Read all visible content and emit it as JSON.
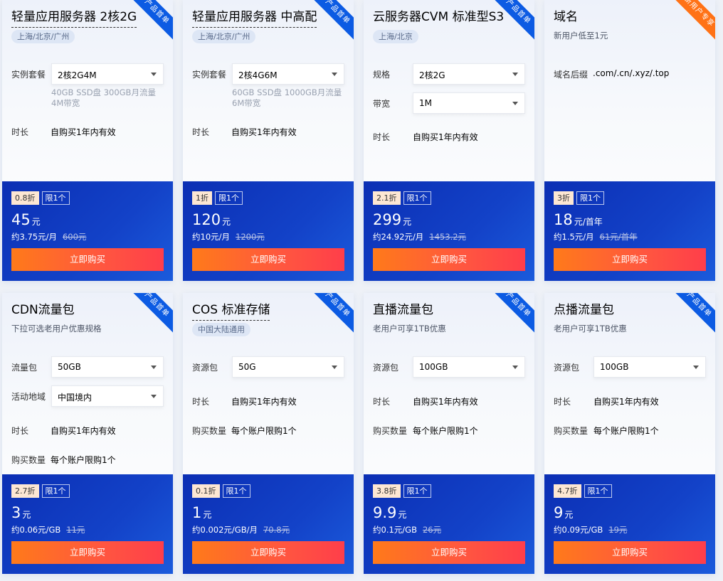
{
  "cards": [
    {
      "ribbon": "产品首单",
      "title": "轻量应用服务器 2核2G",
      "region": "上海/北京/广州",
      "rows": [
        {
          "label": "实例套餐",
          "select": "2核2G4M"
        },
        {
          "label": "时长",
          "value": "自购买1年内有效"
        }
      ],
      "sub": "40GB SSD盘 300GB月流量 4M带宽",
      "discount": "0.8折",
      "limit": "限1个",
      "price": "45",
      "price_unit": "元",
      "per_price": "约3.75元/月",
      "old_price": "600元",
      "buy_label": "立即购买"
    },
    {
      "ribbon": "产品首单",
      "title": "轻量应用服务器 中高配",
      "region": "上海/北京/广州",
      "rows": [
        {
          "label": "实例套餐",
          "select": "2核4G6M"
        },
        {
          "label": "时长",
          "value": "自购买1年内有效"
        }
      ],
      "sub": "60GB SSD盘 1000GB月流量 6M带宽",
      "discount": "1折",
      "limit": "限1个",
      "price": "120",
      "price_unit": "元",
      "per_price": "约10元/月",
      "old_price": "1200元",
      "buy_label": "立即购买"
    },
    {
      "ribbon": "产品首单",
      "title": "云服务器CVM 标准型S3",
      "region": "上海/北京",
      "rows": [
        {
          "label": "规格",
          "select": "2核2G"
        },
        {
          "label": "带宽",
          "select": "1M"
        },
        {
          "label": "时长",
          "value": "自购买1年内有效"
        }
      ],
      "discount": "2.1折",
      "limit": "限1个",
      "price": "299",
      "price_unit": "元",
      "per_price": "约24.92元/月",
      "old_price": "1453.2元",
      "buy_label": "立即购买"
    },
    {
      "ribbon": "新用户专享",
      "title": "域名",
      "desc": "新用户低至1元",
      "rows": [
        {
          "label": "域名后缀",
          "value": ".com/.cn/.xyz/.top"
        }
      ],
      "discount": "3折",
      "limit": "限1个",
      "price": "18",
      "price_unit": "元/首年",
      "per_price": "约1.5元/月",
      "old_price": "61元/首年",
      "buy_label": "立即购买"
    },
    {
      "ribbon": "产品首单",
      "title": "CDN流量包",
      "desc": "下拉可选老用户优惠规格",
      "rows": [
        {
          "label": "流量包",
          "select": "50GB"
        },
        {
          "label": "活动地域",
          "select": "中国境内"
        },
        {
          "label": "时长",
          "value": "自购买1年内有效"
        },
        {
          "label": "购买数量",
          "value": "每个账户限购1个"
        }
      ],
      "discount": "2.7折",
      "limit": "限1个",
      "price": "3",
      "price_unit": "元",
      "per_price": "约0.06元/GB",
      "old_price": "11元",
      "buy_label": "立即购买"
    },
    {
      "ribbon": "产品首单",
      "title": "COS 标准存储",
      "region": "中国大陆通用",
      "rows": [
        {
          "label": "资源包",
          "select": "50G"
        },
        {
          "label": "时长",
          "value": "自购买1年内有效"
        },
        {
          "label": "购买数量",
          "value": "每个账户限购1个"
        }
      ],
      "discount": "0.1折",
      "limit": "限1个",
      "price": "1",
      "price_unit": "元",
      "per_price": "约0.002元/GB/月",
      "old_price": "70.8元",
      "buy_label": "立即购买"
    },
    {
      "ribbon": "产品首单",
      "title": "直播流量包",
      "desc": "老用户可享1TB优惠",
      "rows": [
        {
          "label": "资源包",
          "select": "100GB"
        },
        {
          "label": "时长",
          "value": "自购买1年内有效"
        },
        {
          "label": "购买数量",
          "value": "每个账户限购1个"
        }
      ],
      "discount": "3.8折",
      "limit": "限1个",
      "price": "9.9",
      "price_unit": "元",
      "per_price": "约0.1元/GB",
      "old_price": "26元",
      "buy_label": "立即购买"
    },
    {
      "ribbon": "产品首单",
      "title": "点播流量包",
      "desc": "老用户可享1TB优惠",
      "rows": [
        {
          "label": "资源包",
          "select": "100GB"
        },
        {
          "label": "时长",
          "value": "自购买1年内有效"
        },
        {
          "label": "购买数量",
          "value": "每个账户限购1个"
        }
      ],
      "discount": "4.7折",
      "limit": "限1个",
      "price": "9",
      "price_unit": "元",
      "per_price": "约0.09元/GB",
      "old_price": "19元",
      "buy_label": "立即购买"
    }
  ]
}
